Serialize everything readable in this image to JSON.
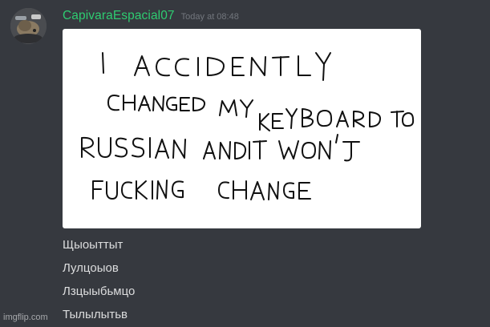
{
  "message": {
    "username": "CapivaraEspacial07",
    "timestamp": "Today at 08:48",
    "username_color": "#2ecc71"
  },
  "attachment": {
    "handwritten_text": "I ACCIDENTLY CHANGED MY KEYBOARD TO RUSSIAN AND IT WON'T FUCKING CHANGE"
  },
  "text_lines": [
    "Щыоыттыт",
    "Лулцоыов",
    "Лзцыыбьмцо",
    "Тылылытьв"
  ],
  "watermark": "imgflip.com",
  "colors": {
    "background": "#36393f",
    "text": "#dcddde",
    "timestamp": "#72767d"
  }
}
